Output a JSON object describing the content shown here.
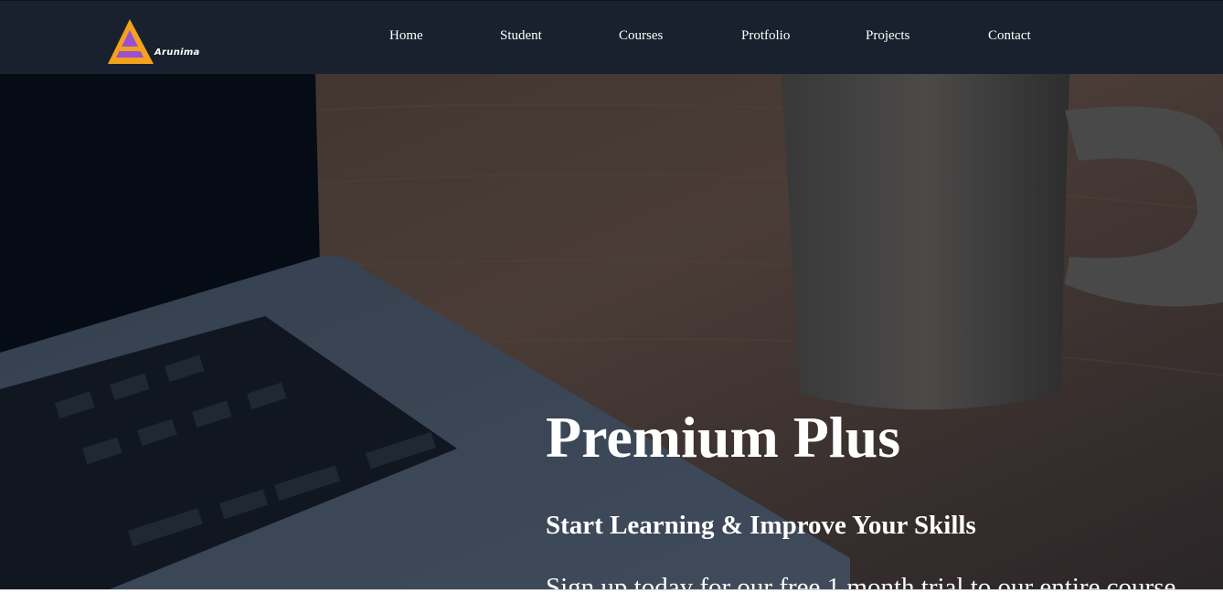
{
  "brand": {
    "name": "Arunima",
    "colors": {
      "triangle": "#f2a21b",
      "letter_fill": "#9b4fd1",
      "navbar_bg": "#19212f"
    }
  },
  "nav": {
    "items": [
      {
        "label": "Home"
      },
      {
        "label": "Student"
      },
      {
        "label": "Courses"
      },
      {
        "label": "Protfolio"
      },
      {
        "label": "Projects"
      },
      {
        "label": "Contact"
      }
    ]
  },
  "hero": {
    "title": "Premium Plus",
    "subtitle": "Start Learning & Improve Your Skills",
    "text": "Sign up today for our free 1 month trial to our entire course",
    "background": "laptop-and-coffee-mug-on-wooden-desk"
  }
}
